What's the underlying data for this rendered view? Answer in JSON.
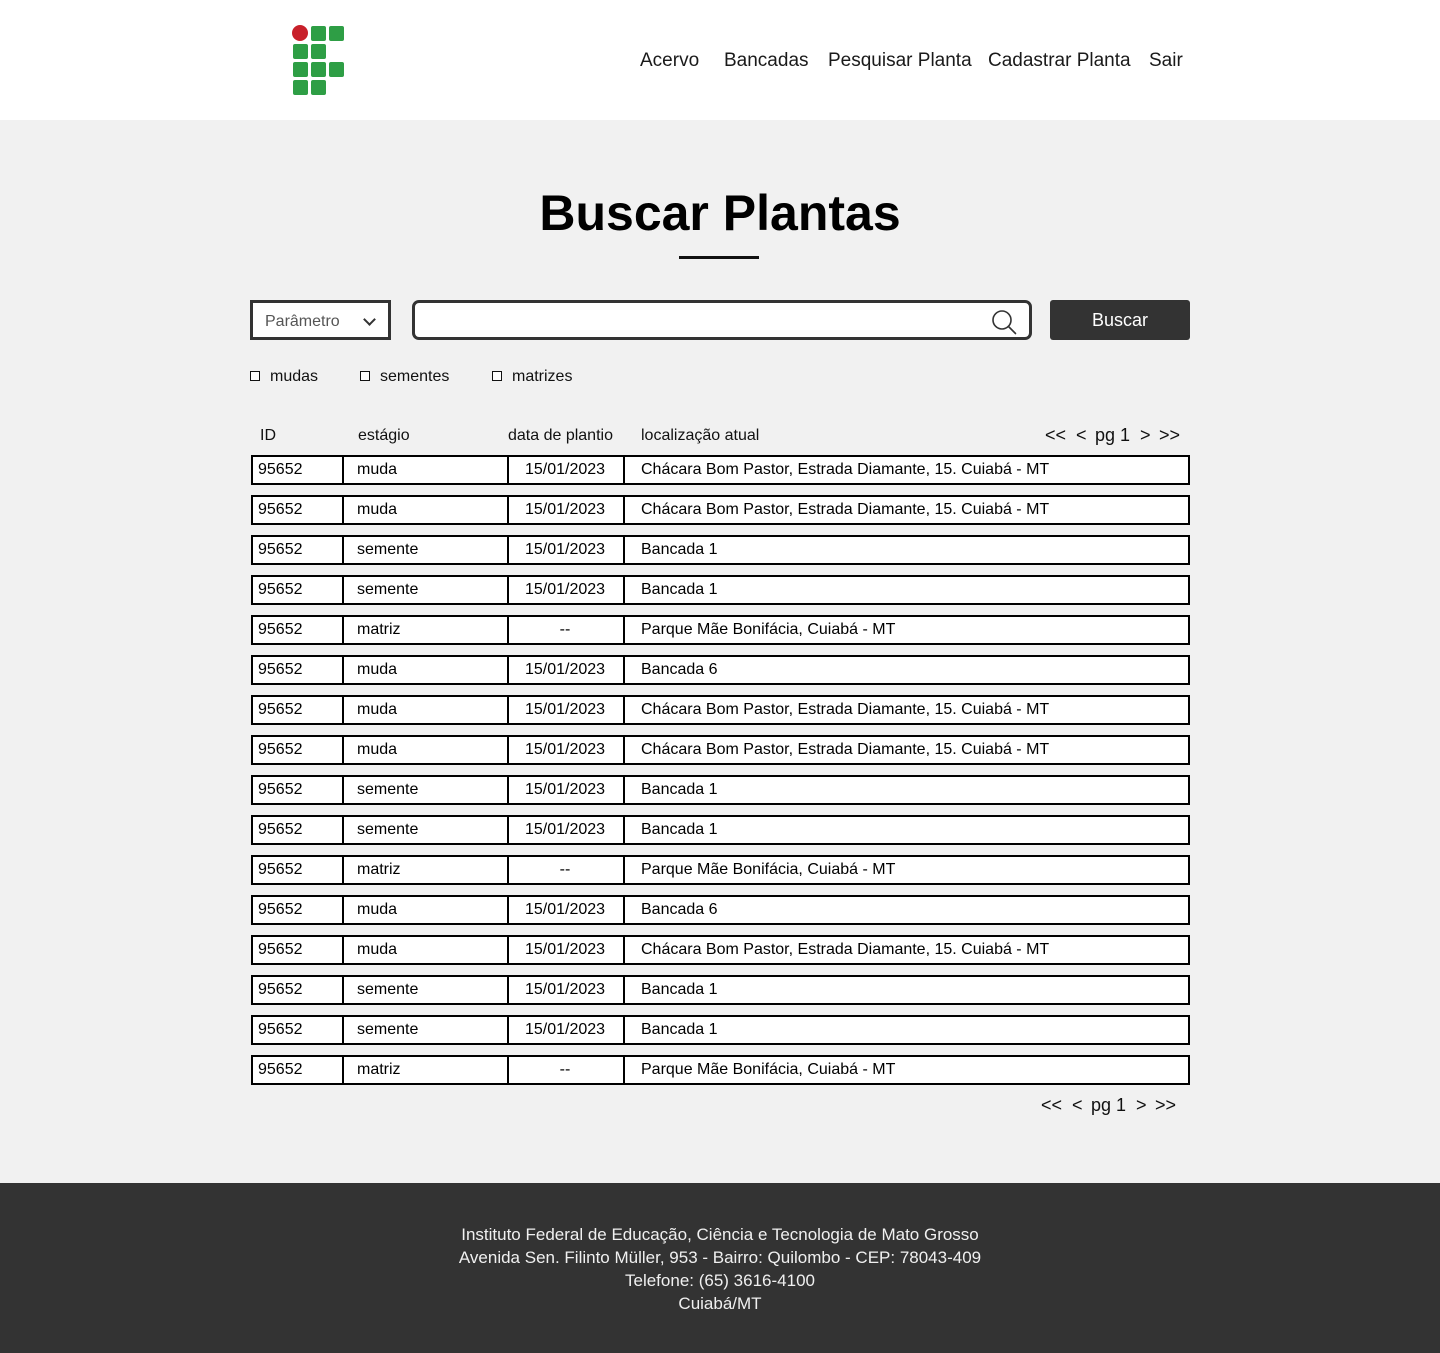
{
  "nav": {
    "items": [
      "Acervo",
      "Bancadas",
      "Pesquisar Planta",
      "Cadastrar Planta",
      "Sair"
    ]
  },
  "page": {
    "title": "Buscar Plantas"
  },
  "search": {
    "parameter_placeholder": "Parâmetro",
    "query_value": "",
    "button_label": "Buscar"
  },
  "filters": [
    "mudas",
    "sementes",
    "matrizes"
  ],
  "table": {
    "headers": [
      "ID",
      "estágio",
      "data de plantio",
      "localização atual"
    ],
    "pager": {
      "first": "<<",
      "prev": "<",
      "page": "pg 1",
      "next": ">",
      "last": ">>"
    },
    "rows": [
      [
        "95652",
        "muda",
        "15/01/2023",
        "Chácara Bom Pastor, Estrada Diamante, 15. Cuiabá - MT"
      ],
      [
        "95652",
        "muda",
        "15/01/2023",
        "Chácara Bom Pastor, Estrada Diamante, 15. Cuiabá - MT"
      ],
      [
        "95652",
        "semente",
        "15/01/2023",
        "Bancada 1"
      ],
      [
        "95652",
        "semente",
        "15/01/2023",
        "Bancada 1"
      ],
      [
        "95652",
        "matriz",
        "--",
        "Parque Mãe Bonifácia, Cuiabá - MT"
      ],
      [
        "95652",
        "muda",
        "15/01/2023",
        "Bancada 6"
      ],
      [
        "95652",
        "muda",
        "15/01/2023",
        "Chácara Bom Pastor, Estrada Diamante, 15. Cuiabá - MT"
      ],
      [
        "95652",
        "muda",
        "15/01/2023",
        "Chácara Bom Pastor, Estrada Diamante, 15. Cuiabá - MT"
      ],
      [
        "95652",
        "semente",
        "15/01/2023",
        "Bancada 1"
      ],
      [
        "95652",
        "semente",
        "15/01/2023",
        "Bancada 1"
      ],
      [
        "95652",
        "matriz",
        "--",
        "Parque Mãe Bonifácia, Cuiabá - MT"
      ],
      [
        "95652",
        "muda",
        "15/01/2023",
        "Bancada 6"
      ],
      [
        "95652",
        "muda",
        "15/01/2023",
        "Chácara Bom Pastor, Estrada Diamante, 15. Cuiabá - MT"
      ],
      [
        "95652",
        "semente",
        "15/01/2023",
        "Bancada 1"
      ],
      [
        "95652",
        "semente",
        "15/01/2023",
        "Bancada 1"
      ],
      [
        "95652",
        "matriz",
        "--",
        "Parque Mãe Bonifácia, Cuiabá - MT"
      ]
    ]
  },
  "footer": {
    "lines": [
      "Instituto Federal de Educação, Ciência e Tecnologia de Mato Grosso",
      "Avenida Sen. Filinto Müller, 953 - Bairro: Quilombo - CEP: 78043-409",
      "Telefone: (65) 3616-4100",
      "Cuiabá/MT"
    ]
  },
  "colors": {
    "logo_green": "#2e9e45",
    "logo_red": "#c8202a",
    "footer_bg": "#333333",
    "button_bg": "#333333"
  }
}
